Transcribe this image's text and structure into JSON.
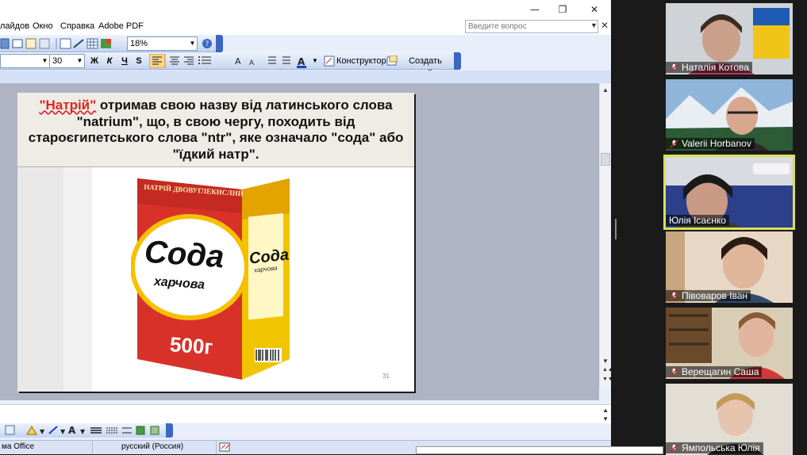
{
  "window": {
    "menu": [
      "лайдов",
      "Окно",
      "Справка",
      "Adobe PDF"
    ],
    "ask_placeholder": "Введите вопрос",
    "zoom": "18%",
    "font_size": "30",
    "format_buttons": [
      "Ж",
      "К",
      "Ч",
      "S"
    ],
    "designer_label": "Конструктор",
    "new_slide_label": "Создать слайд",
    "status_left": "ма Office",
    "status_language": "русский (Россия)"
  },
  "slide": {
    "caption_name": "\"Натрій\"",
    "caption_rest1": " отримав свою назву від латинського слова \"natrium\", що, в свою чергу, походить від староєгипетського слова \"ntr\", яке означало \"сода\" або \"їдкий натр\".",
    "package_top": "НАТРІЙ ДВОВУГЛЕКИСЛИЙ",
    "brand": "Сода",
    "brand_sub": "харчова",
    "weight": "500г",
    "side_brand": "Сода",
    "side_sub": "харчова",
    "page_number": "31"
  },
  "participants": [
    {
      "name": "Наталія Котова",
      "active": false
    },
    {
      "name": "Valerii Horbanov",
      "active": false
    },
    {
      "name": "Юлія Ісаєнко",
      "active": true
    },
    {
      "name": "Півоваров Іван",
      "active": false
    },
    {
      "name": "Верещагин Саша",
      "active": false
    },
    {
      "name": "Ямпольська Юлія",
      "active": false
    }
  ]
}
